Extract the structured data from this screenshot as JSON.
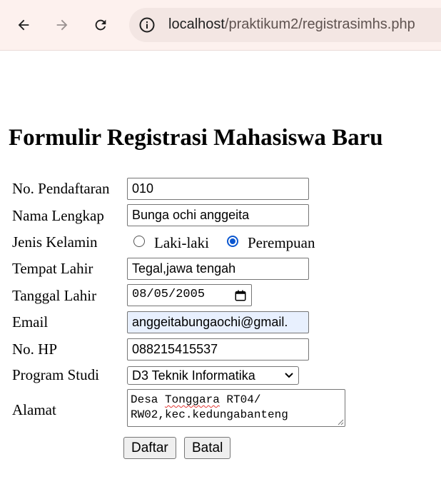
{
  "browser": {
    "url_host": "localhost",
    "url_path": "/praktikum2/registrasimhs.php",
    "back_icon": "arrow-left-icon",
    "forward_icon": "arrow-right-icon",
    "reload_icon": "reload-icon",
    "site_info_icon": "info-icon"
  },
  "page": {
    "title": "Formulir Registrasi Mahasiswa Baru"
  },
  "form": {
    "no_pendaftaran": {
      "label": "No. Pendaftaran",
      "value": "010"
    },
    "nama_lengkap": {
      "label": "Nama Lengkap",
      "value": "Bunga ochi anggeita"
    },
    "jenis_kelamin": {
      "label": "Jenis Kelamin",
      "options": [
        {
          "label": "Laki-laki",
          "checked": false
        },
        {
          "label": "Perempuan",
          "checked": true
        }
      ]
    },
    "tempat_lahir": {
      "label": "Tempat Lahir",
      "value": "Tegal,jawa tengah"
    },
    "tanggal_lahir": {
      "label": "Tanggal Lahir",
      "value": "08/05/2005"
    },
    "email": {
      "label": "Email",
      "value": "anggeitabungaochi@gmail."
    },
    "no_hp": {
      "label": "No. HP",
      "value": "088215415537"
    },
    "program_studi": {
      "label": "Program Studi",
      "value": "D3 Teknik Informatika"
    },
    "alamat": {
      "label": "Alamat",
      "line1_a": "Desa ",
      "line1_b": "Tonggara",
      "line1_c": " RT04/",
      "line2": "RW02,kec.kedungabanteng"
    },
    "buttons": {
      "submit": "Daftar",
      "cancel": "Batal"
    }
  },
  "colors": {
    "chrome_bg": "#fdf1ee",
    "omnibox_bg": "#f3e6e3",
    "radio_checked": "#0b57d0",
    "autofill_bg": "#e8f0fe"
  }
}
